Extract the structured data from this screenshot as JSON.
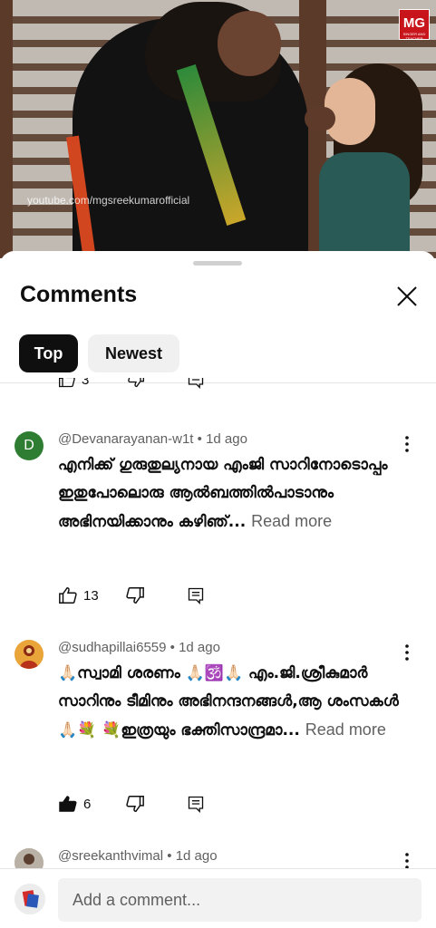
{
  "video": {
    "watermark": "youtube.com/mgsreekumarofficial",
    "logo_text": "MG",
    "logo_subtext": "SINGER AND TEACHER"
  },
  "comments_panel": {
    "title": "Comments",
    "filters": [
      {
        "label": "Top",
        "selected": true
      },
      {
        "label": "Newest",
        "selected": false
      }
    ],
    "previous_comment_likes": "3",
    "comments": [
      {
        "avatar_letter": "D",
        "author": "@Devanarayanan-w1t",
        "age": "1d ago",
        "text": "എനിക്ക് ഗുരുതുല്യനായ എംജി സാറിനോടൊപ്പം ഇതുപോലൊരു ആൽബത്തിൽപാടാനും അഭിനയിക്കാനും കഴിഞ്...",
        "read_more": "Read more",
        "likes": "13",
        "liked": false
      },
      {
        "author": "@sudhapillai6559",
        "age": "1d ago",
        "text": "🙏🏻സ്വാമി ശരണം 🙏🏻🕉️🙏🏻 എം.ജി.ശ്രീകുമാർ സാറിനും ടീമിനും അഭിനന്ദനങ്ങൾ,ആ ശംസകൾ 🙏🏻💐 💐ഇത്രയും ഭക്തിസാന്ദ്രമാ...",
        "read_more": "Read more",
        "likes": "6",
        "liked": true
      },
      {
        "author": "@sreekanthvimal",
        "age": "1d ago"
      }
    ]
  },
  "composer": {
    "placeholder": "Add a comment..."
  },
  "colors": {
    "text_primary": "#0f0f0f",
    "text_secondary": "#606060",
    "chip_selected": "#0f0f0f",
    "chip_unselected": "#f0f0f0",
    "avatar_d": "#2e7d32"
  }
}
